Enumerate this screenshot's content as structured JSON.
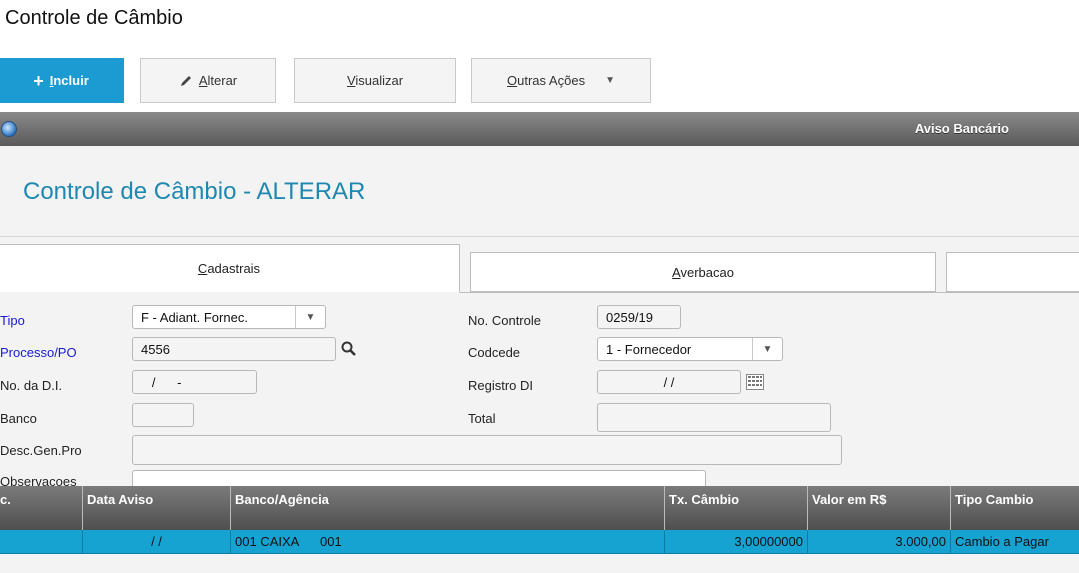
{
  "app": {
    "title": "Controle de Câmbio"
  },
  "toolbar": {
    "incluir": {
      "icon": "+",
      "prefix": "",
      "underline": "I",
      "rest": "ncluir"
    },
    "alterar": {
      "underline": "A",
      "rest": "lterar"
    },
    "visualizar": {
      "underline": "V",
      "rest": "isualizar"
    },
    "outras": {
      "underline": "O",
      "rest": "utras Ações"
    }
  },
  "window": {
    "title": "Aviso Bancário"
  },
  "form": {
    "heading": "Controle de Câmbio - ALTERAR",
    "tabs": [
      {
        "underline": "C",
        "rest": "adastrais"
      },
      {
        "underline": "A",
        "rest": "verbacao"
      }
    ],
    "fields": {
      "tipo": {
        "label": "Tipo",
        "value": "F - Adiant. Fornec."
      },
      "processo": {
        "label": "Processo/PO",
        "value": "4556"
      },
      "di": {
        "label": "No. da D.I.",
        "value": "   /      -"
      },
      "banco": {
        "label": "Banco",
        "value": ""
      },
      "desc": {
        "label": "Desc.Gen.Pro",
        "value": ""
      },
      "obs": {
        "label": "Observacoes",
        "value": ""
      },
      "controle": {
        "label": "No. Controle",
        "value": "0259/19"
      },
      "codcede": {
        "label": "Codcede",
        "value": "1 - Fornecedor"
      },
      "registro": {
        "label": "Registro DI",
        "value": "/ /"
      },
      "total": {
        "label": "Total",
        "value": ""
      }
    }
  },
  "grid": {
    "headers": [
      "c.",
      "Data Aviso",
      "Banco/Agência",
      "Tx. Câmbio",
      "Valor em R$",
      "Tipo Cambio"
    ],
    "rows": [
      {
        "c": "",
        "data": "/ /",
        "banco": "001 CAIXA",
        "agencia": "001",
        "taxa": "3,00000000",
        "valor": "3.000,00",
        "tipo": "Cambio a Pagar"
      }
    ]
  }
}
